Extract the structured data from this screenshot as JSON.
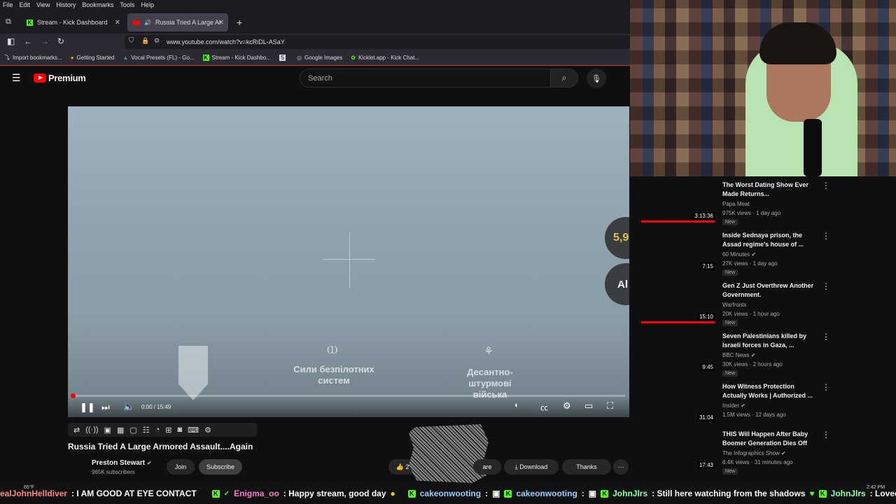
{
  "menubar": [
    "File",
    "Edit",
    "View",
    "History",
    "Bookmarks",
    "Tools",
    "Help"
  ],
  "tabs": [
    {
      "label": "Stream - Kick Dashboard"
    },
    {
      "label": "Russia Tried A Large Armor"
    }
  ],
  "url": "www.youtube.com/watch?v=kcRiDL-ASaY",
  "bookmarks": [
    "Import bookmarks...",
    "Getting Started",
    "Vocal Presets (FL) - Go...",
    "Stream - Kick Dashbo...",
    "",
    "Google Images",
    "Kicklet.app - Kick Chat..."
  ],
  "yt": {
    "brand": "Premium",
    "search_placeholder": "Search"
  },
  "player": {
    "time": "0:00 / 15:49",
    "overlay_left": "Сили безпілотних систем",
    "overlay_right": "Десантно-штурмові війська",
    "badge_num": "5,9",
    "badge_al": "Al"
  },
  "video": {
    "title": "Russia Tried A Large Armored Assault....Again",
    "channel": "Preston Stewart",
    "subscribers": "965K subscribers",
    "join": "Join",
    "subscribe": "Subscribe",
    "like": "2",
    "share": "are",
    "download": "Download",
    "thanks": "Thanks"
  },
  "recs": [
    {
      "title": "The Worst Dating Show Ever Made Returns...",
      "channel": "Papa Meat",
      "meta": "975K views · 1 day ago",
      "new": "New",
      "duration": "3:13:36",
      "progress": 0.95
    },
    {
      "title": "Inside Sednaya prison, the Assad regime's house of ...",
      "channel": "60 Minutes",
      "meta": "27K views · 1 day ago",
      "new": "New",
      "duration": "7:15",
      "progress": 0
    },
    {
      "title": "Gen Z Just Overthrew Another Government.",
      "channel": "Warfronts",
      "meta": "20K views · 1 hour ago",
      "new": "New",
      "duration": "15:10",
      "progress": 0.95
    },
    {
      "title": "Seven Palestinians killed by Israeli forces in Gaza, ...",
      "channel": "BBC News",
      "meta": "30K views · 2 hours ago",
      "new": "New",
      "duration": "9:45",
      "progress": 0
    },
    {
      "title": "How Witness Protection Actually Works | Authorized ...",
      "channel": "Insider",
      "meta": "1.5M views · 12 days ago",
      "new": "",
      "duration": "31:04",
      "progress": 0
    },
    {
      "title": "THIS Will Happen After Baby Boomer Generation Dies Off",
      "channel": "The Infographics Show",
      "meta": "8.4K views · 31 minutes ago",
      "new": "New",
      "duration": "17:43",
      "progress": 0
    }
  ],
  "ticker": [
    {
      "user": "ealJohnHelldiver",
      "msg": ": I AM GOOD AT EYE CONTACT"
    },
    {
      "user": "Enigma_oo",
      "msg": ": Happy stream, good day"
    },
    {
      "user": "cakeonwooting",
      "msg": ":"
    },
    {
      "user": "cakeonwooting",
      "msg": ":"
    },
    {
      "user": "JohnJlrs",
      "msg": ": Still here watching from the shadows"
    },
    {
      "user": "JohnJlrs",
      "msg": ": Loveeeee"
    }
  ],
  "taskbar": {
    "temp": "65°F",
    "clock": "2:42 PM"
  },
  "colors": {
    "accent": "#ff0000",
    "kick": "#53fc18",
    "chat_user": "#c9a6ff"
  }
}
